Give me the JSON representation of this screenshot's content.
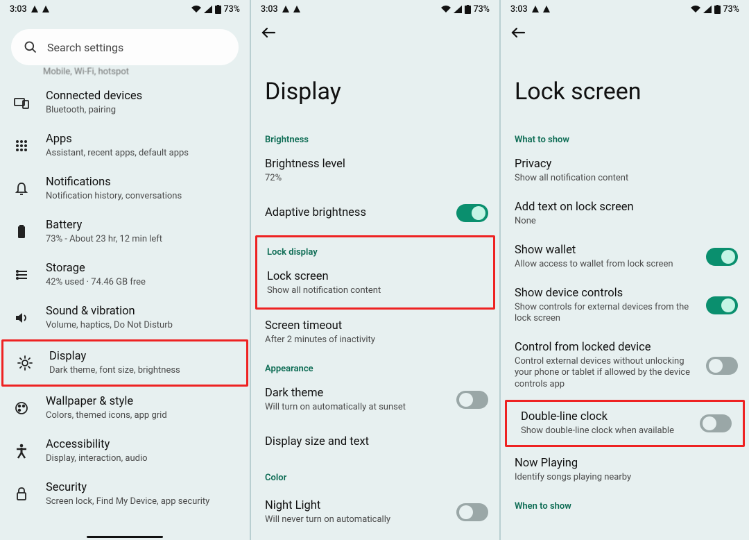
{
  "status": {
    "time": "3:03",
    "battery": "73%"
  },
  "panel1": {
    "search_placeholder": "Search settings",
    "partial_sub": "Mobile, Wi-Fi, hotspot",
    "items": [
      {
        "title": "Connected devices",
        "sub": "Bluetooth, pairing"
      },
      {
        "title": "Apps",
        "sub": "Assistant, recent apps, default apps"
      },
      {
        "title": "Notifications",
        "sub": "Notification history, conversations"
      },
      {
        "title": "Battery",
        "sub": "73% - About 23 hr, 12 min left"
      },
      {
        "title": "Storage",
        "sub": "42% used · 74.46 GB free"
      },
      {
        "title": "Sound & vibration",
        "sub": "Volume, haptics, Do Not Disturb"
      },
      {
        "title": "Display",
        "sub": "Dark theme, font size, brightness"
      },
      {
        "title": "Wallpaper & style",
        "sub": "Colors, themed icons, app grid"
      },
      {
        "title": "Accessibility",
        "sub": "Display, interaction, audio"
      },
      {
        "title": "Security",
        "sub": "Screen lock, Find My Device, app security"
      }
    ]
  },
  "panel2": {
    "title": "Display",
    "sections": {
      "brightness": "Brightness",
      "lock_display": "Lock display",
      "appearance": "Appearance",
      "color": "Color"
    },
    "items": {
      "brightness_level": {
        "title": "Brightness level",
        "sub": "72%"
      },
      "adaptive": {
        "title": "Adaptive brightness"
      },
      "lock_screen": {
        "title": "Lock screen",
        "sub": "Show all notification content"
      },
      "screen_timeout": {
        "title": "Screen timeout",
        "sub": "After 2 minutes of inactivity"
      },
      "dark_theme": {
        "title": "Dark theme",
        "sub": "Will turn on automatically at sunset"
      },
      "display_size": {
        "title": "Display size and text"
      },
      "night_light": {
        "title": "Night Light",
        "sub": "Will never turn on automatically"
      }
    }
  },
  "panel3": {
    "title": "Lock screen",
    "sections": {
      "what_to_show": "What to show",
      "when_to_show": "When to show"
    },
    "items": {
      "privacy": {
        "title": "Privacy",
        "sub": "Show all notification content"
      },
      "add_text": {
        "title": "Add text on lock screen",
        "sub": "None"
      },
      "show_wallet": {
        "title": "Show wallet",
        "sub": "Allow access to wallet from lock screen"
      },
      "device_controls": {
        "title": "Show device controls",
        "sub": "Show controls for external devices from the lock screen"
      },
      "control_locked": {
        "title": "Control from locked device",
        "sub": "Control external devices without unlocking your phone or tablet if allowed by the device controls app"
      },
      "double_line": {
        "title": "Double-line clock",
        "sub": "Show double-line clock when available"
      },
      "now_playing": {
        "title": "Now Playing",
        "sub": "Identify songs playing nearby"
      }
    }
  }
}
